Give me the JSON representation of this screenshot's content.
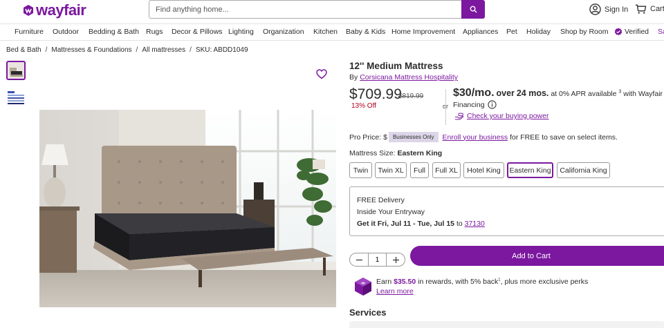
{
  "header": {
    "logo_text": "wayfair",
    "search_placeholder": "Find anything home...",
    "sign_in": "Sign In",
    "cart": "Cart"
  },
  "nav": {
    "items": [
      "Furniture",
      "Outdoor",
      "Bedding & Bath",
      "Rugs",
      "Decor & Pillows",
      "Lighting",
      "Organization",
      "Kitchen",
      "Baby & Kids",
      "Home Improvement",
      "Appliances",
      "Pet",
      "Holiday",
      "Shop by Room"
    ],
    "verified": "Verified",
    "cut_item": "Sa"
  },
  "breadcrumb": {
    "items": [
      "Bed & Bath",
      "Mattresses & Foundations",
      "All mattresses"
    ],
    "sku": "SKU: ABDD1049"
  },
  "product": {
    "title": "12'' Medium Mattress",
    "by_label": "By",
    "brand": "Corsicana Mattress Hospitality",
    "price": "$709.99",
    "was_price": "$819.99",
    "discount": "13% Off",
    "or_label": "or",
    "monthly_amount": "$30/mo.",
    "monthly_over": "over",
    "monthly_months": "24 mos.",
    "monthly_apr": "at 0% APR available",
    "monthly_footnote": "3",
    "monthly_with": "with Wayfair",
    "financing": "Financing",
    "check_power": "Check your buying power",
    "pro_price_label": "Pro Price:",
    "pro_price_blur": "$",
    "businesses_only": "Businesses Only",
    "enroll_link": "Enroll your business",
    "enroll_rest": "for FREE to save on select items.",
    "size_label": "Mattress Size:",
    "size_selected": "Eastern King",
    "sizes": [
      "Twin",
      "Twin XL",
      "Full",
      "Full XL",
      "Hotel King",
      "Eastern King",
      "California King"
    ]
  },
  "delivery": {
    "free": "FREE Delivery",
    "inside": "Inside Your Entryway",
    "get_it": "Get it Fri, Jul 11 - Tue, Jul 15",
    "to": "to",
    "zip": "37130"
  },
  "purchase": {
    "quantity": "1",
    "add_to_cart": "Add to Cart"
  },
  "rewards": {
    "earn": "Earn",
    "amount": "$35.50",
    "text1": "in rewards, with 5% back",
    "footnote": "1",
    "text2": ", plus more exclusive perks",
    "learn_more": "Learn more"
  },
  "services": {
    "title": "Services"
  },
  "colors": {
    "brand": "#7b189f",
    "discount": "#b3001b"
  }
}
